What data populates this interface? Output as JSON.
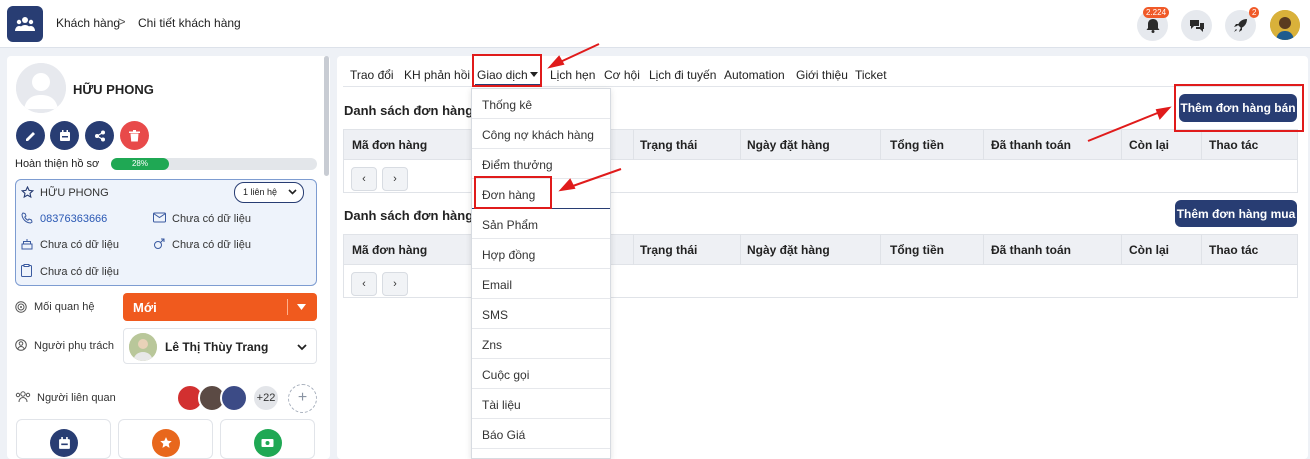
{
  "breadcrumb": {
    "first": "Khách hàng",
    "sep": ">",
    "second": "Chi tiết khách hàng"
  },
  "header": {
    "notifications_badge": "2.224",
    "rocket_badge": "2"
  },
  "profile": {
    "name": "HỮU PHONG",
    "progress_label": "Hoàn thiện hồ sơ",
    "progress_value": "28%",
    "progress_fraction": 0.28
  },
  "info": {
    "name": "HỮU PHONG",
    "contact_select": "1 liên hệ",
    "phone": "08376363666",
    "email": "Chưa có dữ liệu",
    "field3": "Chưa có dữ liệu",
    "gender": "Chưa có dữ liệu",
    "field5": "Chưa có dữ liệu"
  },
  "relation": {
    "label": "Mối quan hệ",
    "value": "Mới"
  },
  "owner": {
    "label": "Người phụ trách",
    "value": "Lê Thị Thùy Trang"
  },
  "related": {
    "label": "Người liên quan",
    "more": "+22",
    "add": "+"
  },
  "tabs": [
    "Trao đổi",
    "KH phản hồi",
    "Giao dịch",
    "Lịch hẹn",
    "Cơ hội",
    "Lịch đi tuyến",
    "Automation",
    "Giới thiệu",
    "Ticket"
  ],
  "dropdown": [
    "Thống kê",
    "Công nợ khách hàng",
    "Điểm thưởng",
    "Đơn hàng",
    "Sản Phẩm",
    "Hợp đồng",
    "Email",
    "SMS",
    "Zns",
    "Cuộc gọi",
    "Tài liệu",
    "Báo Giá"
  ],
  "section1": {
    "title": "Danh sách đơn hàng b",
    "button": "Thêm đơn hàng bán"
  },
  "section2": {
    "title": "Danh sách đơn hàng n",
    "button": "Thêm đơn hàng mua"
  },
  "columns": [
    "Mã đơn hàng",
    "Trạng thái",
    "Ngày đặt hàng",
    "Tổng tiền",
    "Đã thanh toán",
    "Còn lại",
    "Thao tác"
  ],
  "pager": {
    "prev": "‹",
    "next": "›"
  },
  "colors": {
    "primary": "#283d73",
    "accent": "#f05a1e",
    "success": "#1fa854",
    "highlight": "#e01b1b"
  }
}
